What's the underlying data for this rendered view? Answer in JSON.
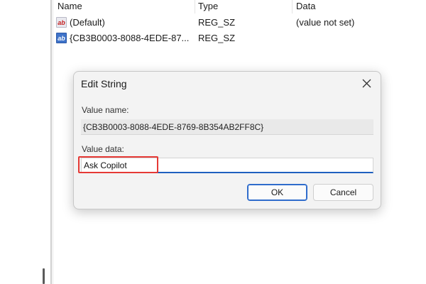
{
  "list": {
    "columns": {
      "name": "Name",
      "type": "Type",
      "data": "Data"
    },
    "rows": [
      {
        "name": "(Default)",
        "type": "REG_SZ",
        "data": "(value not set)",
        "icon": "string-value-icon"
      },
      {
        "name": "{CB3B0003-8088-4EDE-87...",
        "type": "REG_SZ",
        "data": "",
        "icon": "string-value-icon",
        "selected": true
      }
    ],
    "icon_text": "ab"
  },
  "dialog": {
    "title": "Edit String",
    "value_name_label": "Value name:",
    "value_name": "{CB3B0003-8088-4EDE-8769-8B354AB2FF8C}",
    "value_data_label": "Value data:",
    "value_data": "Ask Copilot",
    "ok_label": "OK",
    "cancel_label": "Cancel",
    "highlight_color": "#e53935",
    "focus_color": "#1f5fbf"
  }
}
